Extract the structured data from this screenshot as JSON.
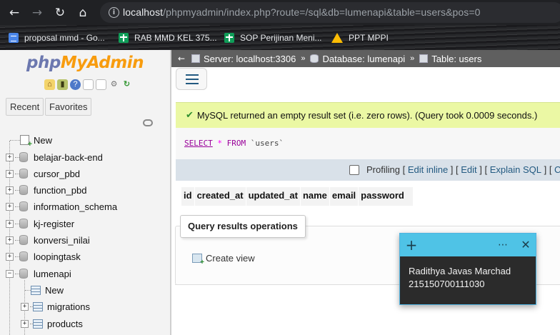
{
  "browser": {
    "url_host": "localhost",
    "url_path": "/phpmyadmin/index.php?route=/sql&db=lumenapi&table=users&pos=0",
    "bookmarks": [
      {
        "label": "proposal mmd - Go...",
        "icon": "docs-icon"
      },
      {
        "label": "RAB MMD KEL 375...",
        "icon": "sheets-icon"
      },
      {
        "label": "SOP Perijinan Meni...",
        "icon": "sheets-icon"
      },
      {
        "label": "PPT MPPI",
        "icon": "drive-icon"
      }
    ]
  },
  "sidebar": {
    "logo_php": "php",
    "logo_myadmin": "MyAdmin",
    "tab_recent": "Recent",
    "tab_favorites": "Favorites",
    "tree": [
      {
        "label": "New",
        "type": "new"
      },
      {
        "label": "belajar-back-end",
        "type": "db"
      },
      {
        "label": "cursor_pbd",
        "type": "db"
      },
      {
        "label": "function_pbd",
        "type": "db"
      },
      {
        "label": "information_schema",
        "type": "db"
      },
      {
        "label": "kj-register",
        "type": "db"
      },
      {
        "label": "konversi_nilai",
        "type": "db"
      },
      {
        "label": "loopingtask",
        "type": "db"
      },
      {
        "label": "lumenapi",
        "type": "db",
        "expanded": true
      },
      {
        "label": "New",
        "type": "new-table"
      },
      {
        "label": "migrations",
        "type": "table"
      },
      {
        "label": "products",
        "type": "table"
      }
    ]
  },
  "breadcrumb": {
    "server": "Server: localhost:3306",
    "database": "Database: lumenapi",
    "table": "Table: users",
    "separator": "»"
  },
  "message": {
    "success": "MySQL returned an empty result set (i.e. zero rows). (Query took 0.0009 seconds.)"
  },
  "sql": {
    "select": "SELECT",
    "star": "*",
    "from": "FROM",
    "table": "`users`"
  },
  "options": {
    "profiling": "Profiling",
    "edit_inline": "Edit inline",
    "edit": "Edit",
    "explain": "Explain SQL",
    "cut": "C",
    "profiling_checked": false
  },
  "results": {
    "columns": [
      "id",
      "created_at",
      "updated_at",
      "name",
      "email",
      "password"
    ]
  },
  "query_ops": {
    "legend": "Query results operations",
    "create_view": "Create view"
  },
  "sticky_note": {
    "line1": "Radithya Javas Marchad",
    "line2": "215150700111030",
    "header_color": "#4fc3e6"
  }
}
